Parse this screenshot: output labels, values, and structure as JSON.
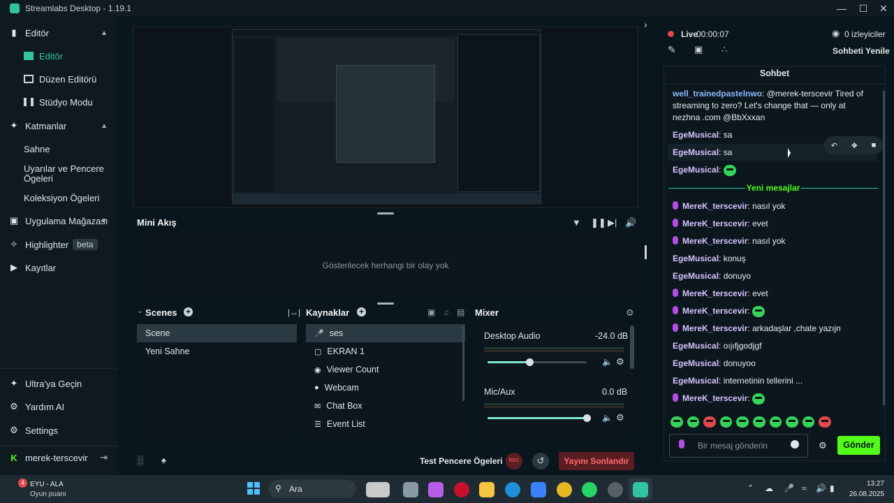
{
  "window": {
    "title": "Streamlabs Desktop - 1.19.1"
  },
  "sidebar": {
    "editor_label": "Editör",
    "items": [
      {
        "label": "Editör"
      },
      {
        "label": "Düzen Editörü"
      },
      {
        "label": "Stüdyo Modu"
      }
    ],
    "layers_label": "Katmanlar",
    "layer_items": [
      {
        "label": "Sahne"
      },
      {
        "label": "Uyarılar ve Pencere Ögeleri"
      },
      {
        "label": "Koleksiyon Ögeleri"
      }
    ],
    "app_store": "Uygulama Mağazası",
    "highlighter": "Highlighter",
    "beta": "beta",
    "recordings": "Kayıtlar",
    "ultra": "Ultra'ya Geçin",
    "help": "Yardım AI",
    "settings": "Settings",
    "user": "merek-terscevir"
  },
  "mini_feed": {
    "title": "Mini Akış",
    "empty": "Gösterilecek herhangi bir olay yok"
  },
  "scenes": {
    "title": "Scenes",
    "items": [
      "Scene",
      "Yeni Sahne"
    ]
  },
  "sources": {
    "title": "Kaynaklar",
    "items": [
      "ses",
      "EKRAN 1",
      "Viewer Count",
      "Webcam",
      "Chat Box",
      "Event List"
    ]
  },
  "mixer": {
    "title": "Mixer",
    "channels": [
      {
        "name": "Desktop Audio",
        "db": "-24.0 dB",
        "level": 0.42
      },
      {
        "name": "Mic/Aux",
        "db": "0.0 dB",
        "level": 1.0
      }
    ]
  },
  "footer": {
    "test_widgets": "Test Pencere Ögeleri",
    "rec": "REC",
    "end_stream": "Yayını Sonlandır"
  },
  "chat_header": {
    "live": "Live",
    "time": "00:00:07",
    "viewers": "0 izleyiciler",
    "refresh": "Sohbeti Yenile"
  },
  "chat": {
    "title": "Sohbet",
    "new_messages": "Yeni mesajlar",
    "input_placeholder": "Bir mesaj gönderin",
    "send": "Gönder",
    "messages": [
      {
        "user": "well_trainedpastelnwo",
        "text": ": @merek-terscevir Tired of streaming to zero? Let's change that — only at nezhna .com @BbXxxan"
      },
      {
        "user": "EgeMusical",
        "text": ": sa"
      },
      {
        "user": "EgeMusical",
        "text": ": sa"
      },
      {
        "user": "EgeMusical",
        "text": ":"
      },
      {
        "user": "MereK_terscevir",
        "text": ": nasıl yok"
      },
      {
        "user": "MereK_terscevir",
        "text": ": evet"
      },
      {
        "user": "MereK_terscevir",
        "text": ": nasıl yok"
      },
      {
        "user": "EgeMusical",
        "text": ": konuş"
      },
      {
        "user": "EgeMusical",
        "text": ": donuyo"
      },
      {
        "user": "MereK_terscevir",
        "text": ": evet"
      },
      {
        "user": "MereK_terscevir",
        "text": ":"
      },
      {
        "user": "MereK_terscevir",
        "text": ": arkadaşlar ,chate yazıjn"
      },
      {
        "user": "EgeMusical",
        "text": ": oıjıfjgodjgf"
      },
      {
        "user": "EgeMusical",
        "text": ": donuyoo"
      },
      {
        "user": "EgeMusical",
        "text": ": internetinin tellerini ..."
      },
      {
        "user": "MereK_terscevir",
        "text": ":"
      }
    ]
  },
  "taskbar": {
    "notif_count": "4",
    "weather_title": "EYU - ALA",
    "weather_sub": "Oyun puanı",
    "search": "Ara",
    "time": "13:27",
    "date": "26.08.2025"
  },
  "colors": {
    "accent": "#31c3a2",
    "live": "#e5484d",
    "send": "#53fc18",
    "end": "#5a1d22"
  }
}
